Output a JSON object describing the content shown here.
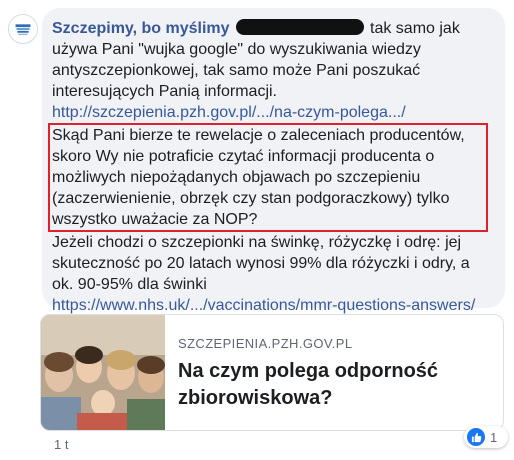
{
  "comment": {
    "author": "Szczepimy, bo myślimy",
    "intro_tail": "tak samo jak",
    "lines": [
      "używa Pani \"wujka google\" do wyszukiwania wiedzy",
      "antyszczepionkowej, tak samo może Pani poszukać",
      "interesujących Panią informacji."
    ],
    "link1": "http://szczepienia.pzh.gov.pl/.../na-czym-polega.../",
    "highlighted_lines": [
      "Skąd Pani bierze te rewelacje o zaleceniach producentów,",
      "skoro Wy nie potraficie czytać informacji producenta o",
      "możliwych niepożądanych objawach po szczepieniu",
      "(zaczerwienienie, obrzęk czy stan podgoraczkowy) tylko",
      "wszystko uważacie za NOP?"
    ],
    "after_lines": [
      "Jeżeli chodzi o szczepionki na świnkę, różyczkę i odrę: jej",
      "skuteczność po 20 latach wynosi 99% dla różyczki i odry, a",
      "ok. 90-95% dla świnki"
    ],
    "link2": "https://www.nhs.uk/.../vaccinations/mmr-questions-answers/"
  },
  "link_preview": {
    "domain": "SZCZEPIENIA.PZH.GOV.PL",
    "title": "Na czym polega odporność zbiorowiskowa?"
  },
  "meta": {
    "time": "1 t",
    "reaction_count": "1"
  },
  "colors": {
    "link": "#385898",
    "highlight_border": "#e0202a",
    "bubble": "#f0f2f5",
    "like": "#1877f2"
  },
  "icons": {
    "avatar": "page-logo-icon",
    "like": "thumbs-up-icon"
  }
}
